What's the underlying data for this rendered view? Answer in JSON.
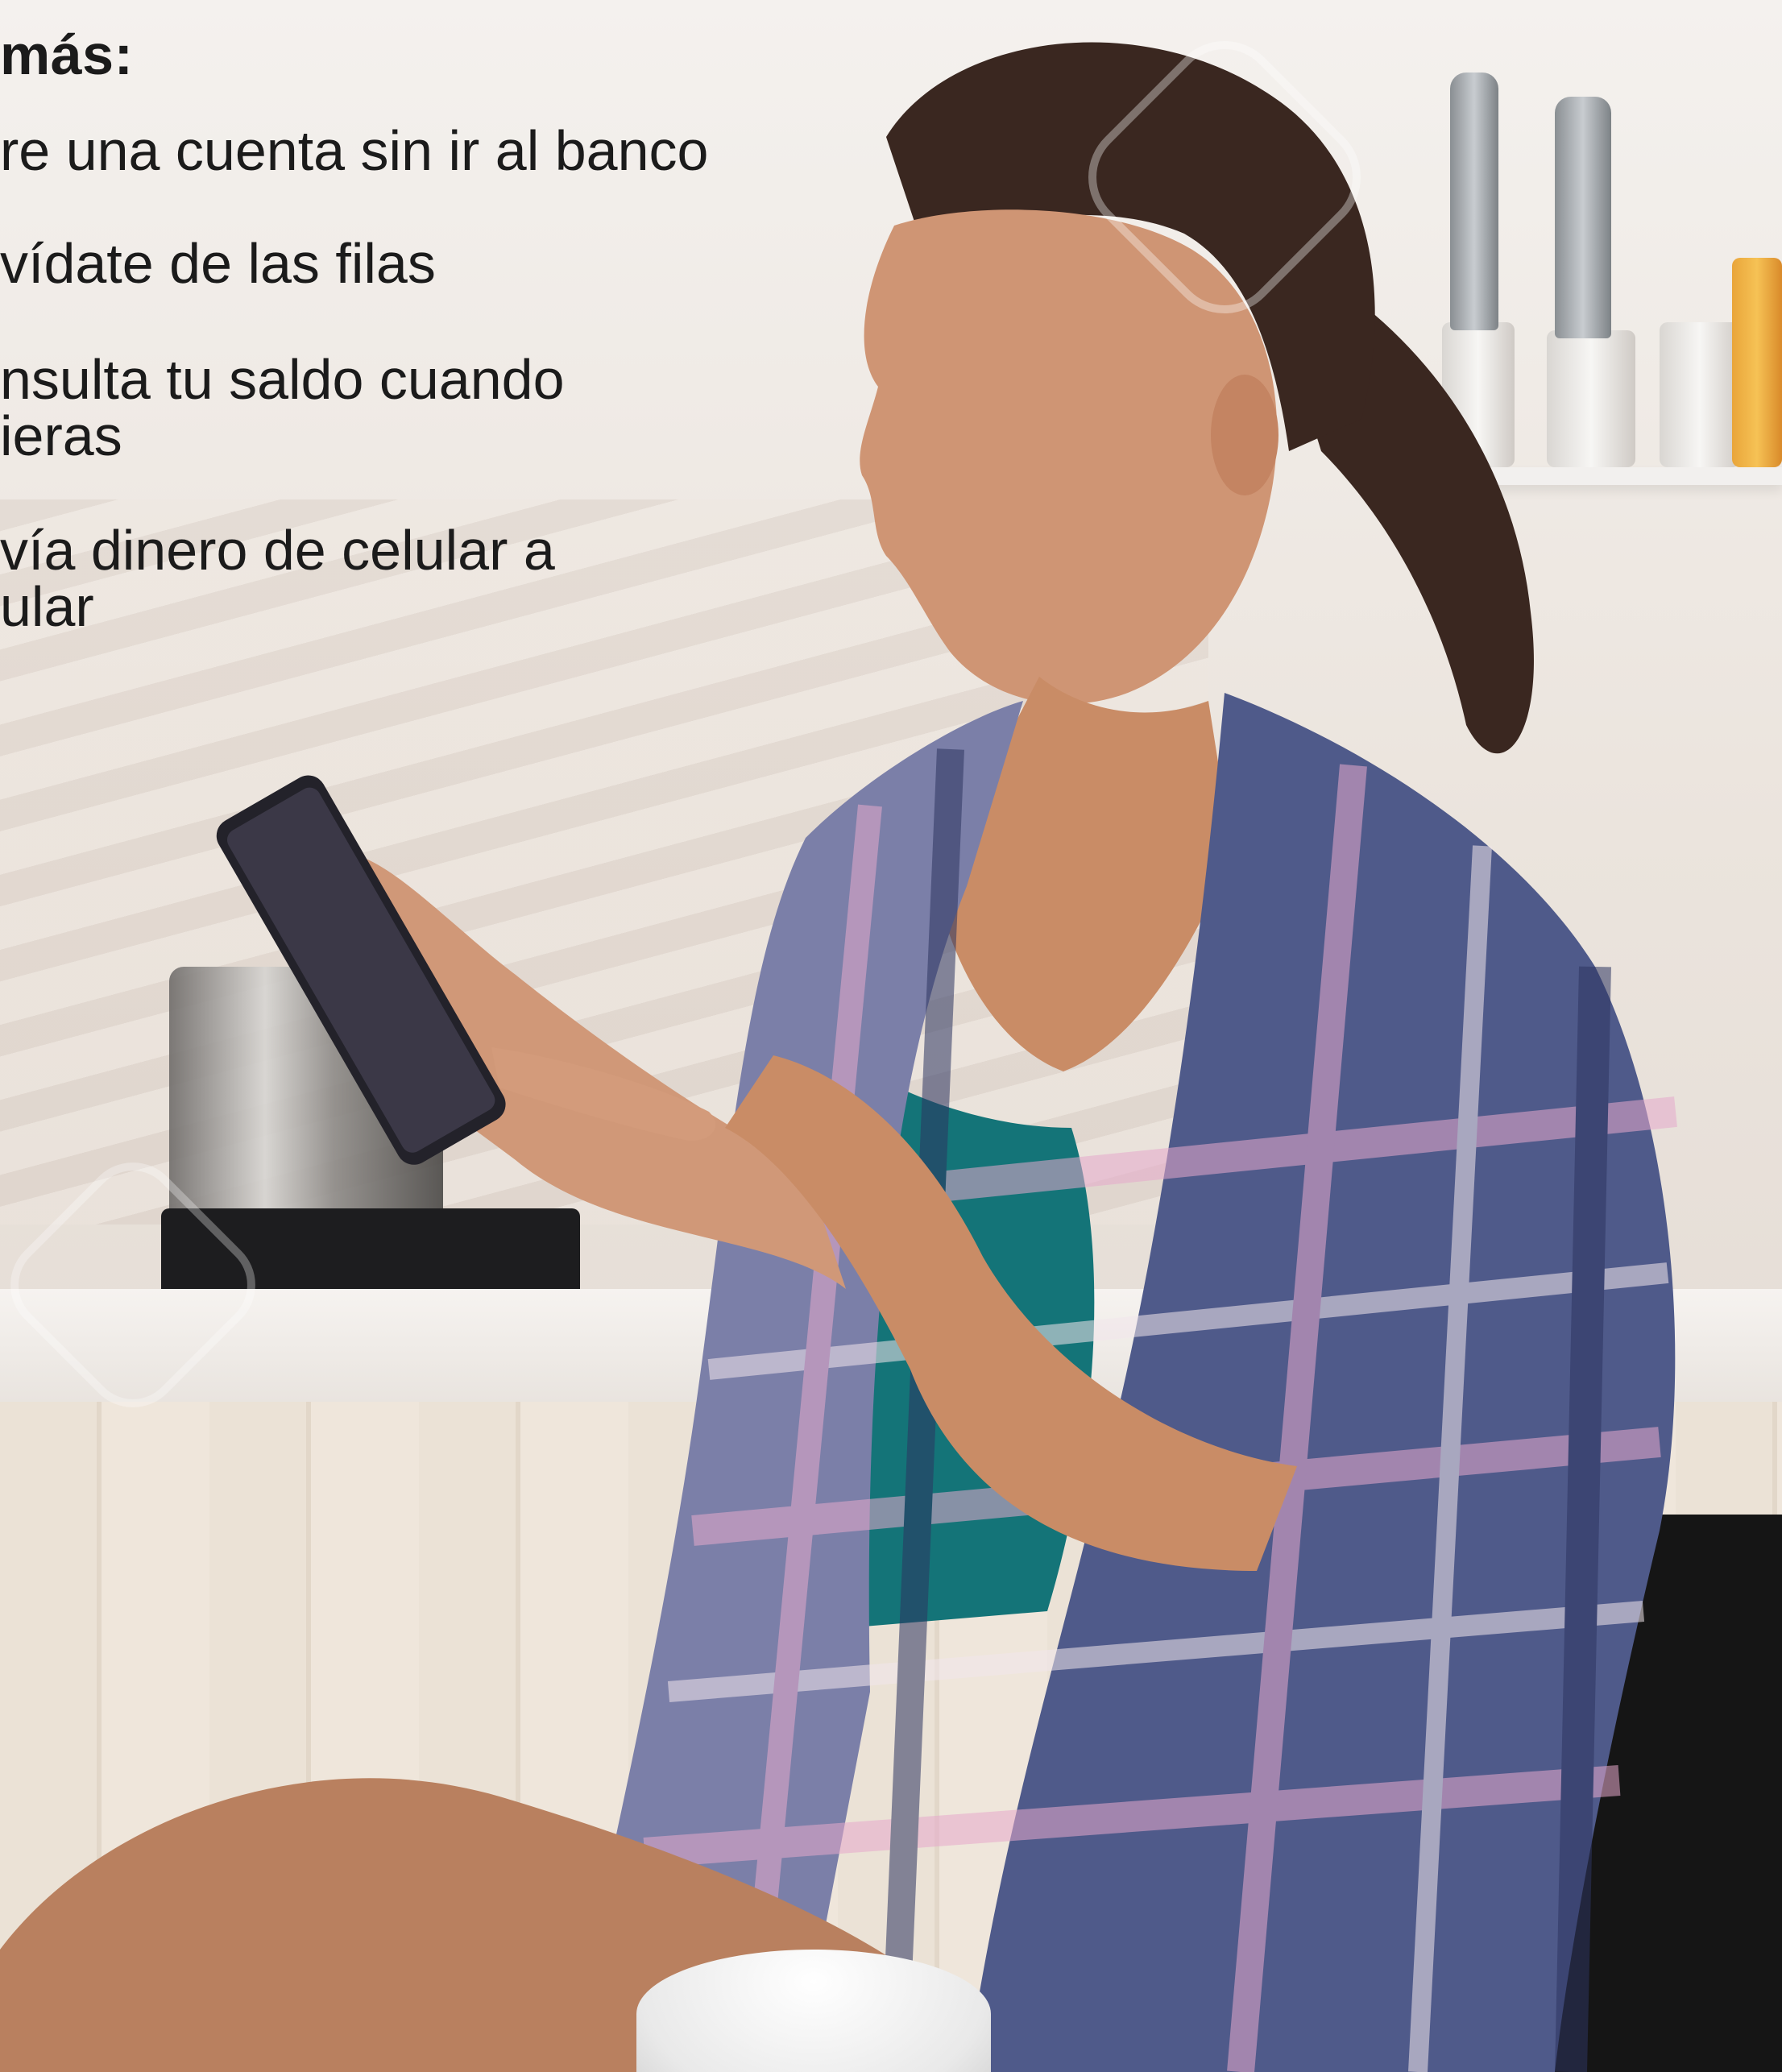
{
  "heading": "más:",
  "items": [
    {
      "lines": [
        "re una cuenta sin ir al banco"
      ]
    },
    {
      "lines": [
        "vídate de las filas"
      ]
    },
    {
      "lines": [
        "nsulta tu saldo cuando",
        "ieras"
      ]
    },
    {
      "lines": [
        "vía dinero de celular a",
        "ular"
      ]
    }
  ],
  "colors": {
    "text": "#1b1b1b",
    "shirt_pink": "#c98fb4",
    "shirt_navy": "#3f4a78",
    "top_teal": "#147478",
    "skin": "#c98c66",
    "hair": "#3a2720"
  }
}
